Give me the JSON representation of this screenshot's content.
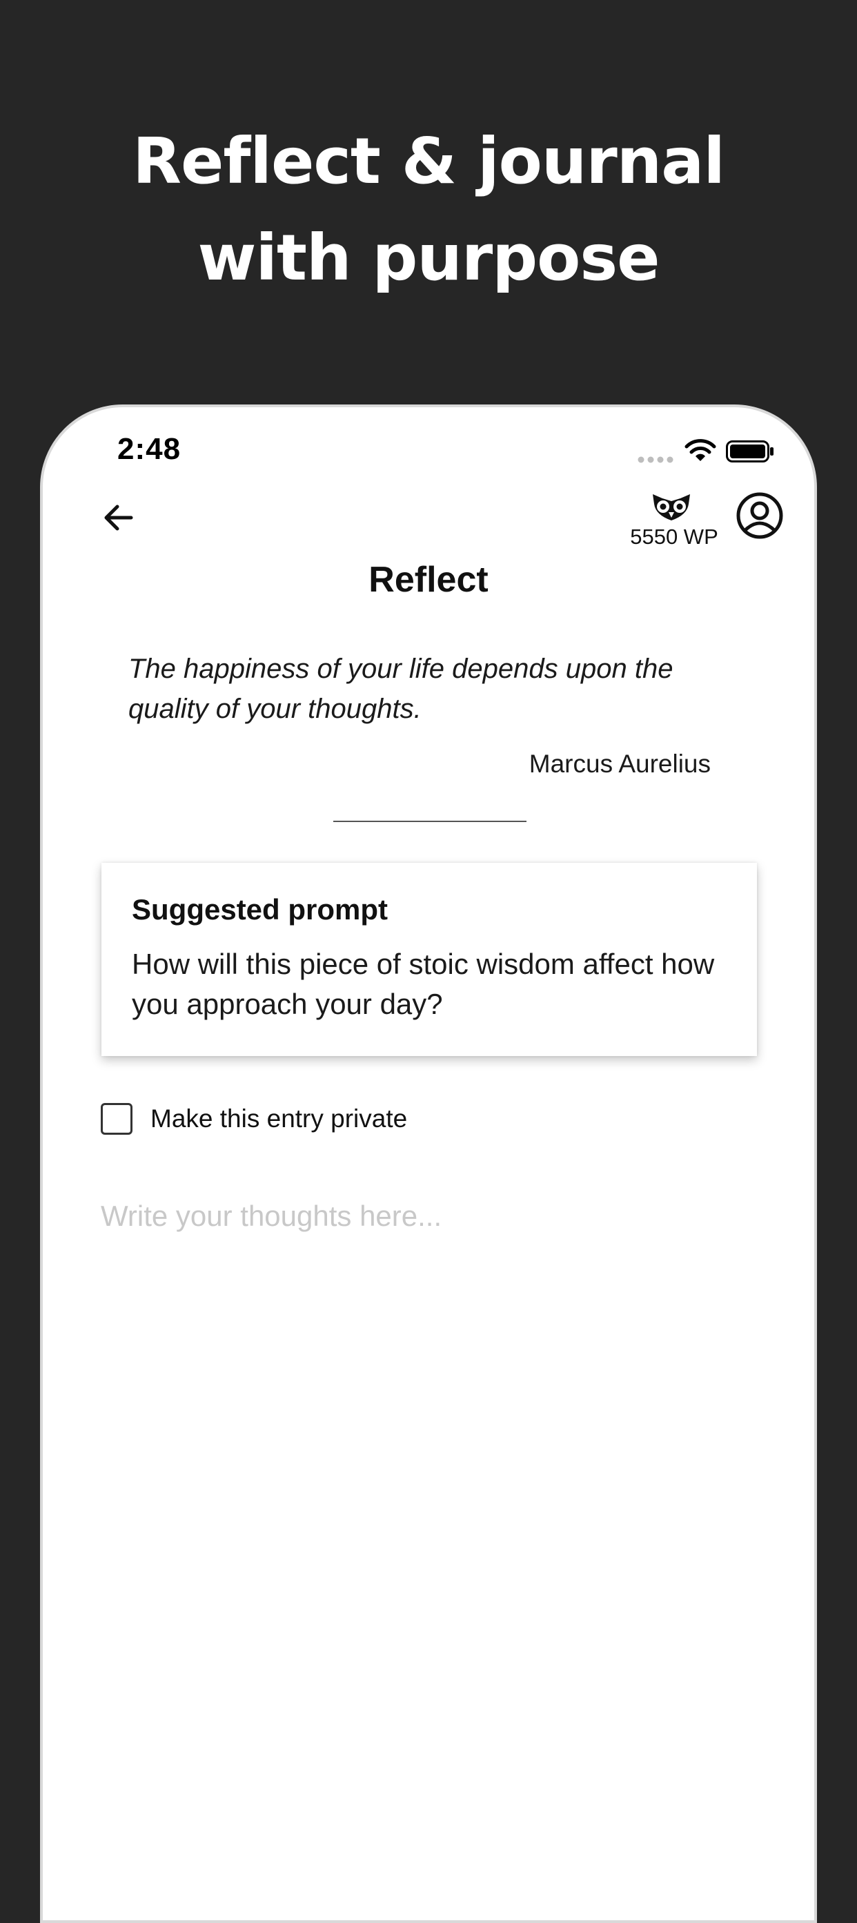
{
  "headline": {
    "line1": "Reflect & journal",
    "line2": "with purpose"
  },
  "status_bar": {
    "time": "2:48"
  },
  "header": {
    "wp_count": "5550 WP",
    "title": "Reflect"
  },
  "quote": {
    "text": "The happiness of your life depends upon the quality of your thoughts.",
    "author": "Marcus Aurelius"
  },
  "prompt_card": {
    "title": "Suggested prompt",
    "body": "How will this piece of stoic wisdom affect how you approach your day?"
  },
  "private_option": {
    "label": "Make this entry private",
    "checked": false
  },
  "journal_input": {
    "placeholder": "Write your thoughts here..."
  },
  "colors": {
    "background": "#262626",
    "card": "#ffffff",
    "text": "#111111",
    "placeholder": "#c8c8c8"
  }
}
